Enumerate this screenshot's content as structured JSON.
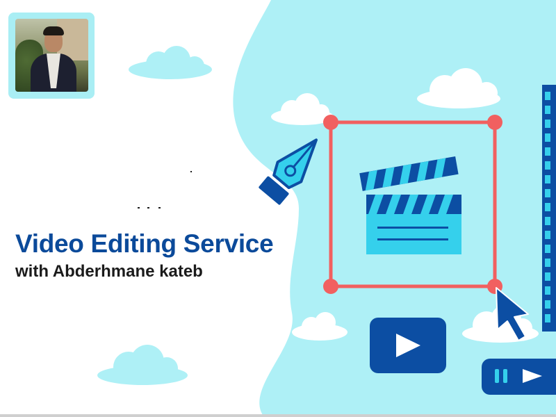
{
  "header": {
    "title": "Video Editing Service",
    "subtitle": "with Abderhmane kateb"
  },
  "colors": {
    "title": "#0b4a9a",
    "subtitle": "#1b1b1b",
    "blob": "#aef0f6",
    "frame": "#f16060",
    "dark_blue": "#0c4ea3",
    "light_cyan": "#35d0ec"
  },
  "icons": {
    "pen": "pen-tool-icon",
    "clapper": "clapperboard-icon",
    "cursor": "cursor-icon",
    "play": "play-icon",
    "pause": "pause-icon",
    "film": "film-strip-icon"
  }
}
